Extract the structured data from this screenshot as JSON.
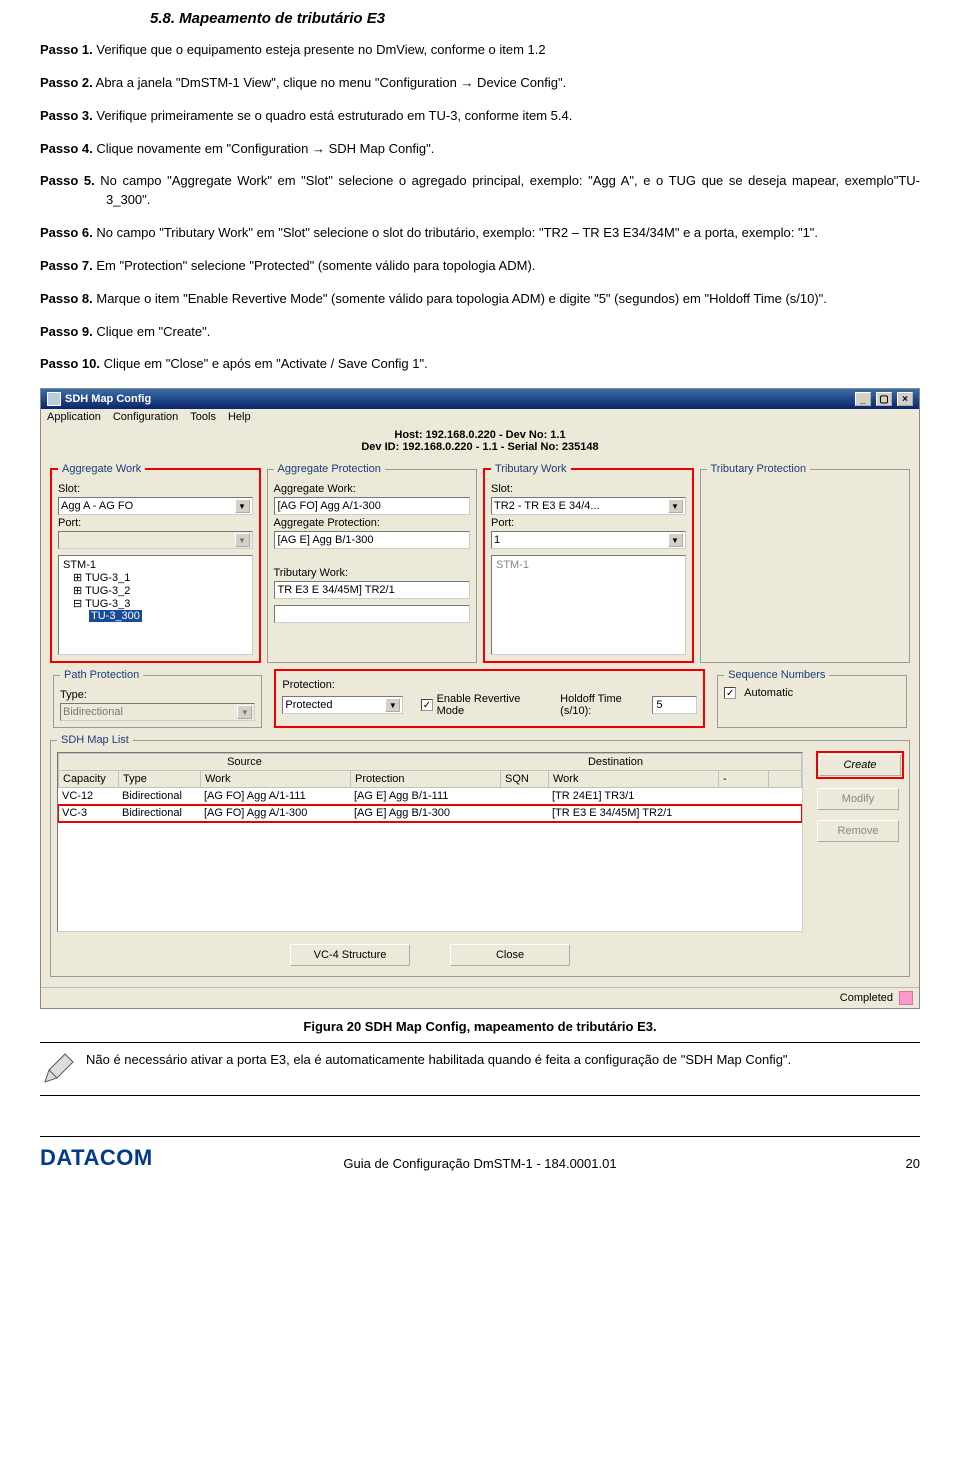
{
  "section_title": "5.8. Mapeamento de tributário E3",
  "passos": [
    {
      "label": "Passo 1.",
      "text": " Verifique que o equipamento esteja presente no DmView, conforme o item 1.2"
    },
    {
      "label": "Passo 2.",
      "text": " Abra a janela \"DmSTM-1 View\", clique no menu \"Configuration → Device Config\"."
    },
    {
      "label": "Passo 3.",
      "text": " Verifique primeiramente se o quadro está estruturado em TU-3, conforme item 5.4."
    },
    {
      "label": "Passo 4.",
      "text": " Clique novamente em \"Configuration → SDH Map Config\"."
    },
    {
      "label": "Passo 5.",
      "text": " No campo \"Aggregate Work\" em \"Slot\" selecione o agregado principal, exemplo: \"Agg A\", e o TUG que se deseja mapear, exemplo\"TU-3_300\"."
    },
    {
      "label": "Passo 6.",
      "text": " No campo \"Tributary Work\" em \"Slot\" selecione o slot do tributário, exemplo: \"TR2 – TR E3 E34/34M\" e a porta, exemplo: \"1\"."
    },
    {
      "label": "Passo 7.",
      "text": " Em \"Protection\" selecione \"Protected\" (somente válido para topologia ADM)."
    },
    {
      "label": "Passo 8.",
      "text": " Marque o item \"Enable Revertive Mode\" (somente válido para topologia ADM) e digite \"5\" (segundos) em \"Holdoff Time (s/10)\"."
    },
    {
      "label": "Passo 9.",
      "text": " Clique em \"Create\"."
    },
    {
      "label": "Passo 10.",
      "text": " Clique em \"Close\" e após em \"Activate / Save Config 1\"."
    }
  ],
  "window": {
    "title": "SDH Map Config",
    "menu": [
      "Application",
      "Configuration",
      "Tools",
      "Help"
    ],
    "host": "Host: 192.168.0.220 - Dev No: 1.1",
    "devid": "Dev ID: 192.168.0.220 - 1.1 - Serial No: 235148",
    "agg_work": {
      "legend": "Aggregate Work",
      "slot_label": "Slot:",
      "slot_value": "Agg A - AG FO",
      "port_label": "Port:",
      "port_value": "",
      "tree": [
        "STM-1",
        "TUG-3_1",
        "TUG-3_2",
        "TUG-3_3",
        "TU-3_300"
      ]
    },
    "agg_prot": {
      "legend": "Aggregate Protection",
      "agg_work_label": "Aggregate Work:",
      "agg_work_value": "[AG FO] Agg A/1-300",
      "agg_prot_label": "Aggregate Protection:",
      "agg_prot_value": "[AG E] Agg B/1-300",
      "trib_work_label": "Tributary Work:",
      "trib_work_value": "TR E3 E 34/45M] TR2/1",
      "blank": ""
    },
    "trib_work": {
      "legend": "Tributary Work",
      "slot_label": "Slot:",
      "slot_value": "TR2 - TR E3 E 34/4...",
      "port_label": "Port:",
      "port_value": "1",
      "tree_label": "STM-1"
    },
    "trib_prot": {
      "legend": "Tributary Protection"
    },
    "path": {
      "legend": "Path Protection",
      "type_label": "Type:",
      "type_value": "Bidirectional"
    },
    "prot": {
      "prot_label": "Protection:",
      "prot_value": "Protected",
      "enable_revertive": "Enable Revertive Mode",
      "holdoff_label": "Holdoff Time (s/10):",
      "holdoff_value": "5"
    },
    "seq": {
      "legend": "Sequence Numbers",
      "auto": "Automatic"
    },
    "maplist": {
      "legend": "SDH Map List",
      "group_source": "Source",
      "group_dest": "Destination",
      "cols": [
        "Capacity",
        "Type",
        "Work",
        "Protection",
        "SQN",
        "Work",
        "-"
      ],
      "rows": [
        {
          "cap": "VC-12",
          "type": "Bidirectional",
          "work": "[AG FO] Agg A/1-111",
          "prot": "[AG E] Agg B/1-111",
          "sqn": "",
          "dwork": "[TR 24E1] TR3/1",
          "dash": ""
        },
        {
          "cap": "VC-3",
          "type": "Bidirectional",
          "work": "[AG FO] Agg A/1-300",
          "prot": "[AG E] Agg B/1-300",
          "sqn": "",
          "dwork": "[TR E3 E 34/45M] TR2/1",
          "dash": ""
        }
      ],
      "btn_create": "Create",
      "btn_modify": "Modify",
      "btn_remove": "Remove",
      "btn_vc4": "VC-4 Structure",
      "btn_close": "Close"
    },
    "status": "Completed"
  },
  "fig_caption": "Figura 20 SDH Map Config, mapeamento de tributário E3.",
  "note_text": "Não é necessário ativar a porta E3, ela é automaticamente habilitada quando é feita a configuração de \"SDH Map Config\".",
  "footer": {
    "brand": "DATACOM",
    "mid": "Guia de Configuração DmSTM-1 - 184.0001.01",
    "page": "20"
  }
}
